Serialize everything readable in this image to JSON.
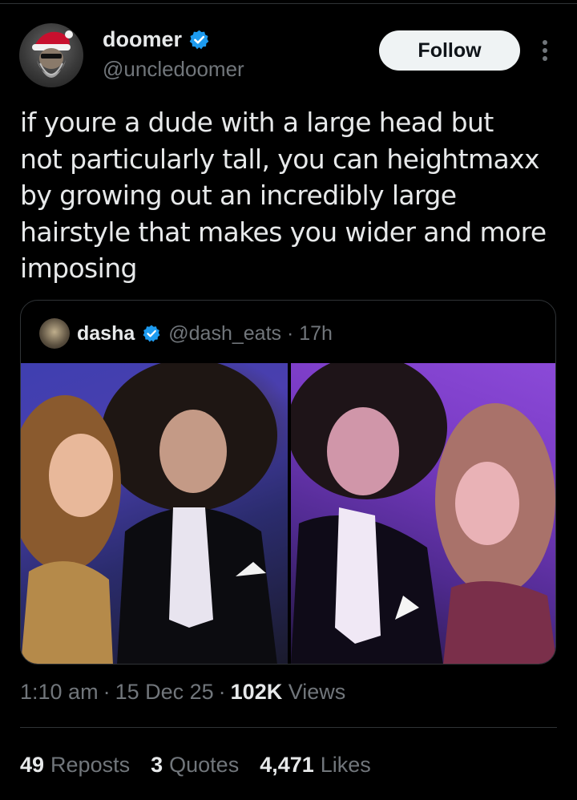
{
  "author": {
    "display_name": "doomer",
    "handle": "@uncledoomer",
    "verified_icon": "verified-badge-icon",
    "follow_label": "Follow"
  },
  "tweet": {
    "text": "if youre a dude with a large head but\nnot particularly tall, you can heightmaxx\nby growing out an incredibly large\nhairstyle that makes you wider and more\nimposing"
  },
  "quoted": {
    "display_name": "dasha",
    "handle_time": "@dash_eats · 17h",
    "photo_count": 2
  },
  "meta": {
    "time": "1:10 am",
    "sep1": "·",
    "date": "15 Dec 25",
    "sep2": "·",
    "views_count": "102K",
    "views_label": "Views"
  },
  "stats": {
    "reposts_count": "49",
    "reposts_label": "Reposts",
    "quotes_count": "3",
    "quotes_label": "Quotes",
    "likes_count": "4,471",
    "likes_label": "Likes"
  },
  "colors": {
    "background": "#000000",
    "text_primary": "#e7e9ea",
    "text_secondary": "#71767b",
    "verified": "#1d9bf0",
    "border": "#2f3336",
    "follow_bg": "#eff3f4"
  }
}
